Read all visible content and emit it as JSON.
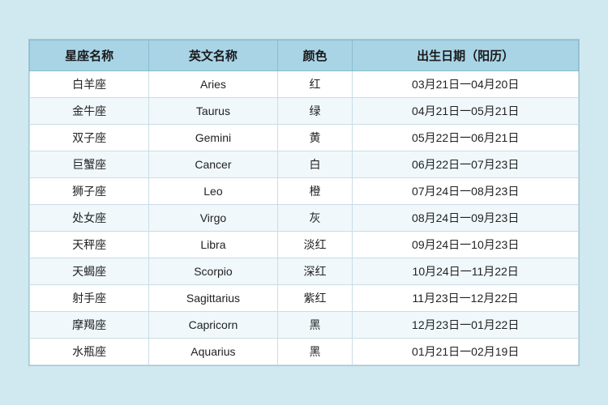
{
  "table": {
    "headers": [
      "星座名称",
      "英文名称",
      "颜色",
      "出生日期（阳历）"
    ],
    "rows": [
      [
        "白羊座",
        "Aries",
        "红",
        "03月21日一04月20日"
      ],
      [
        "金牛座",
        "Taurus",
        "绿",
        "04月21日一05月21日"
      ],
      [
        "双子座",
        "Gemini",
        "黄",
        "05月22日一06月21日"
      ],
      [
        "巨蟹座",
        "Cancer",
        "白",
        "06月22日一07月23日"
      ],
      [
        "狮子座",
        "Leo",
        "橙",
        "07月24日一08月23日"
      ],
      [
        "处女座",
        "Virgo",
        "灰",
        "08月24日一09月23日"
      ],
      [
        "天秤座",
        "Libra",
        "淡红",
        "09月24日一10月23日"
      ],
      [
        "天蝎座",
        "Scorpio",
        "深红",
        "10月24日一11月22日"
      ],
      [
        "射手座",
        "Sagittarius",
        "紫红",
        "11月23日一12月22日"
      ],
      [
        "摩羯座",
        "Capricorn",
        "黑",
        "12月23日一01月22日"
      ],
      [
        "水瓶座",
        "Aquarius",
        "黑",
        "01月21日一02月19日"
      ]
    ]
  }
}
